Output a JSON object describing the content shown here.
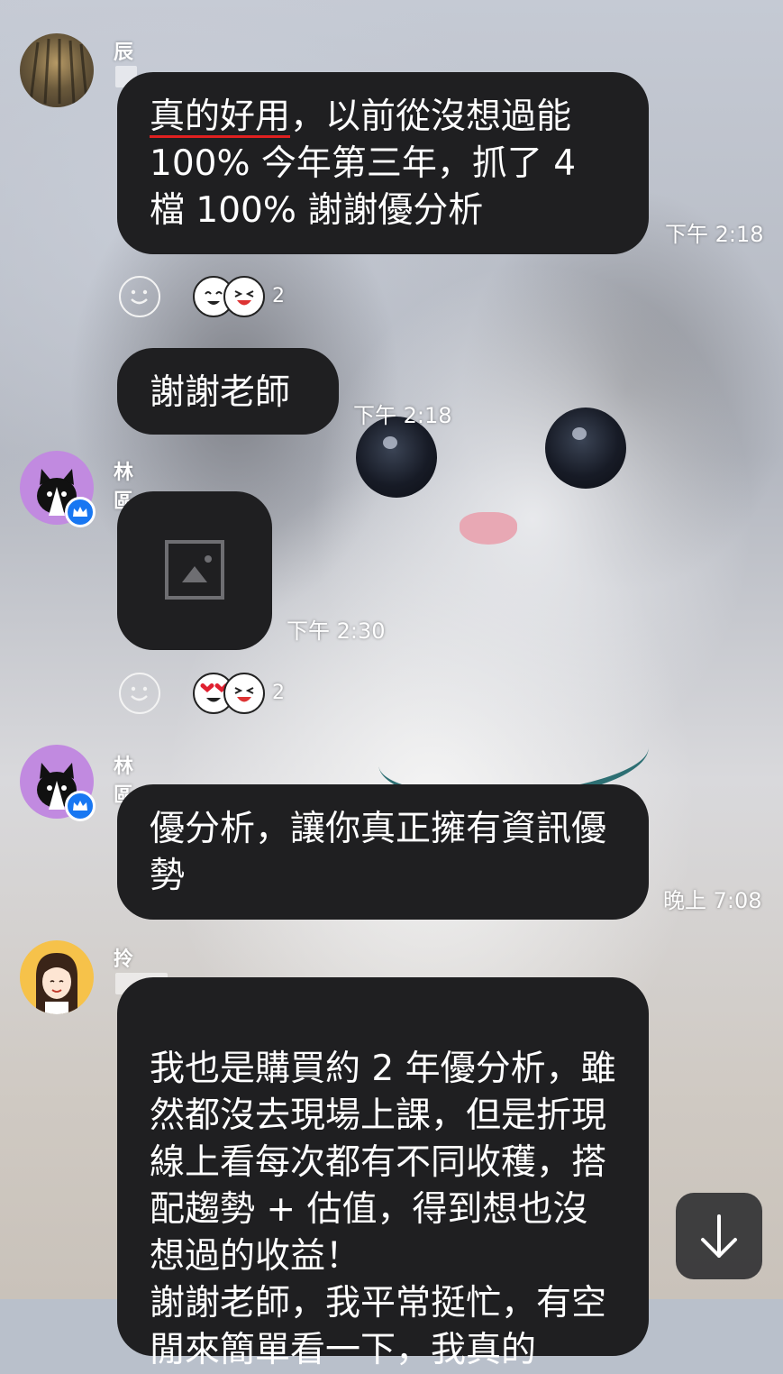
{
  "messages": [
    {
      "sender": "辰",
      "text_highlight": "真的好用",
      "text": "，以前從沒想過能 100% 今年第三年，抓了 4 檔 100% 謝謝優分析",
      "time": "下午 2:18",
      "reaction_count": "2"
    },
    {
      "text": "謝謝老師",
      "time": "下午 2:18"
    },
    {
      "sender": "林區",
      "image_placeholder": "image-icon",
      "time": "下午 2:30",
      "reaction_count": "2"
    },
    {
      "sender": "林區",
      "text": "優分析，讓你真正擁有資訊優勢",
      "time": "晚上 7:08"
    },
    {
      "sender": "拎",
      "text": "我也是購買約 2 年優分析，雖然都沒去現場上課，但是折現線上看每次都有不同收穫，搭配趨勢 + 估值，得到想也沒想過的收益！\n謝謝老師，我平常挺忙，有空閒來簡單看一下，我真的"
    }
  ],
  "icons": {
    "scroll_down": "arrow-down-icon",
    "add_reaction": "smiley-icon",
    "official_badge": "crown-badge-icon"
  },
  "colors": {
    "bubble": "#1f1f21",
    "highlight_underline": "#e02020",
    "badge": "#1877f2"
  }
}
